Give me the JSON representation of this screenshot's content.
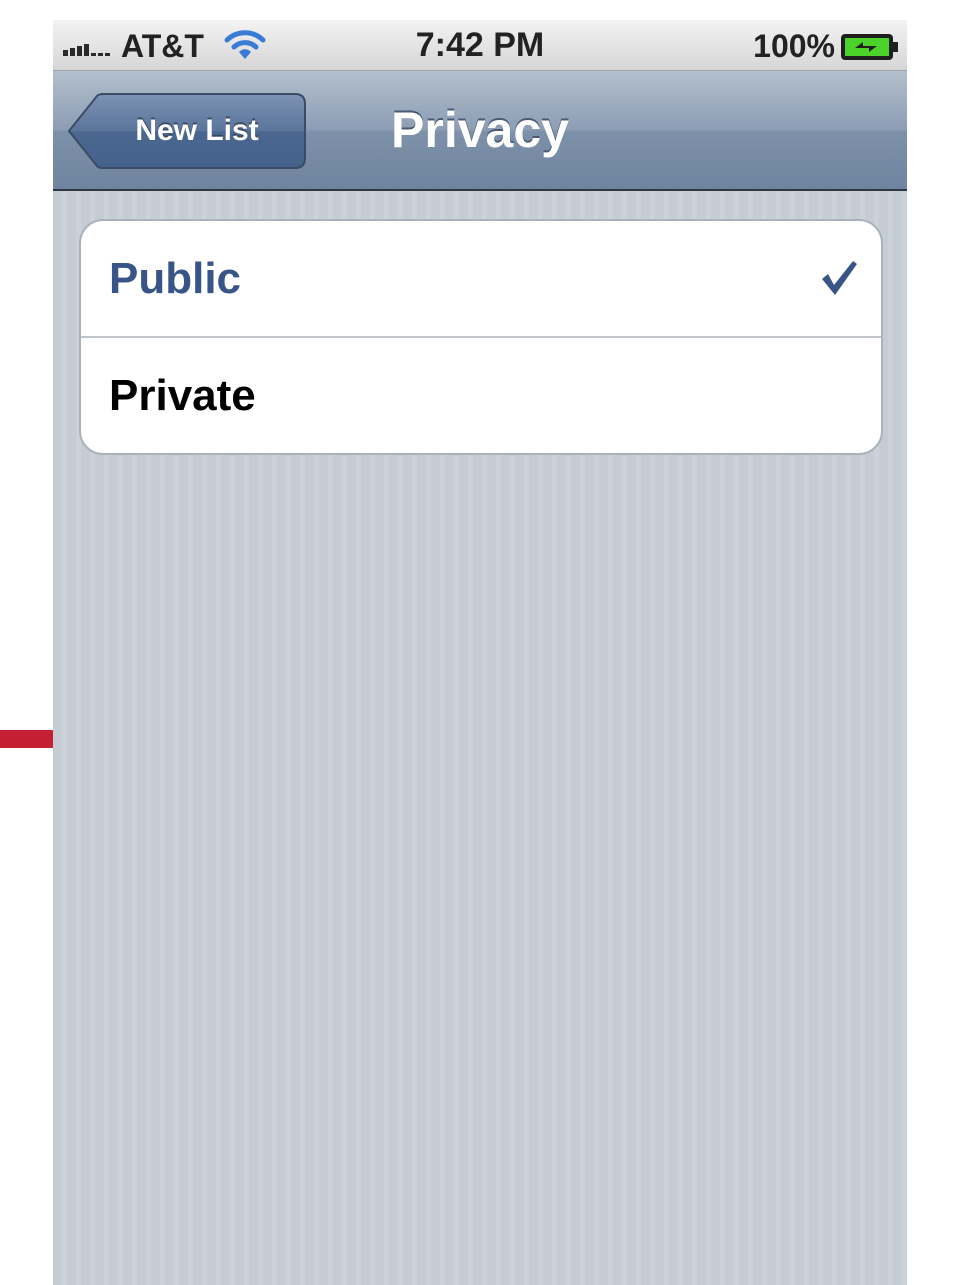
{
  "status_bar": {
    "carrier": "AT&T",
    "time": "7:42 PM",
    "battery_percent": "100%",
    "icons": [
      "signal-bars-icon",
      "wifi-icon",
      "battery-charging-icon"
    ]
  },
  "nav_bar": {
    "back_label": "New List",
    "title": "Privacy"
  },
  "privacy_options": [
    {
      "label": "Public",
      "selected": true
    },
    {
      "label": "Private",
      "selected": false
    }
  ],
  "colors": {
    "selected_text": "#395587",
    "nav_bar": "#7e91aa",
    "background_stripes": "#c5ccd4",
    "battery_fill": "#4cd32a"
  }
}
